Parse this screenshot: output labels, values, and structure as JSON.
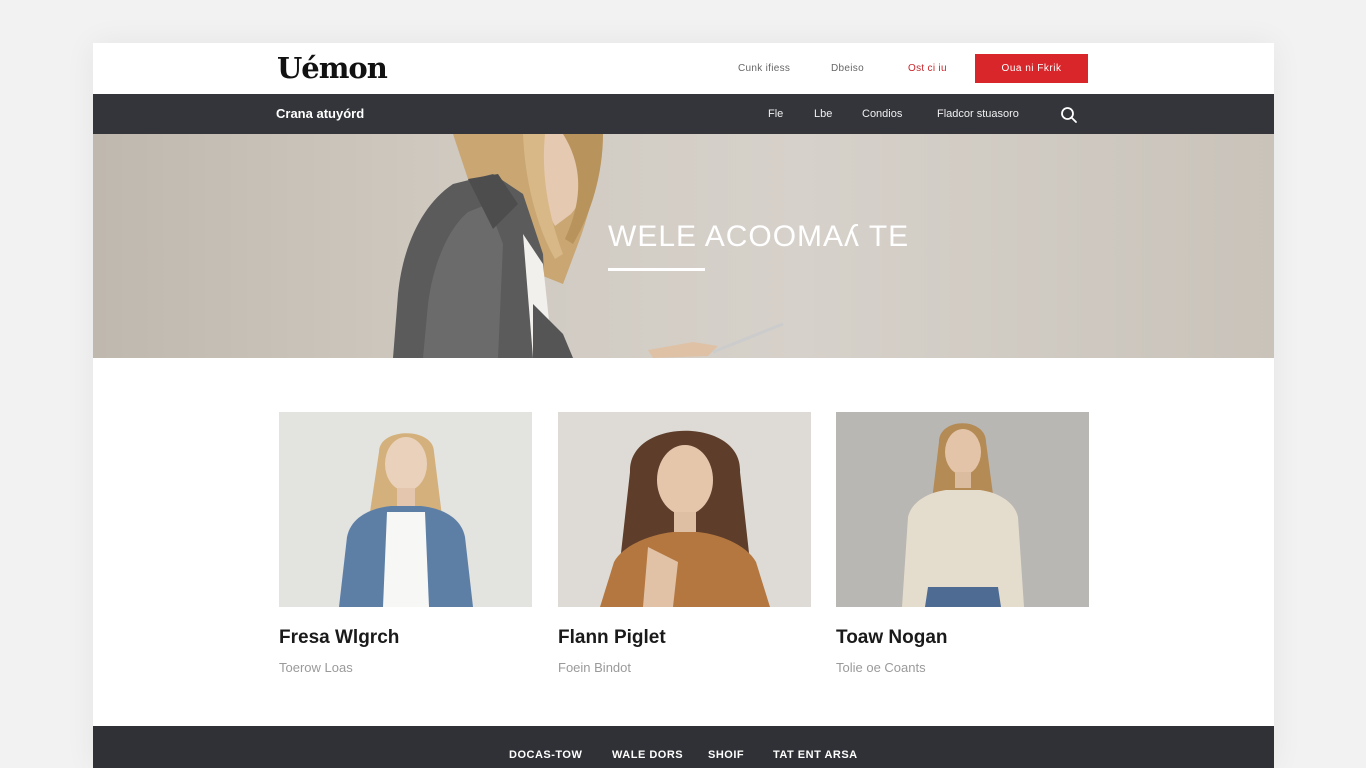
{
  "header": {
    "logo": "Uémon",
    "links": [
      "Cunk ifiess",
      "Dbeiso",
      "Ost ci iu"
    ],
    "cta_label": "Oua ni Fkrik",
    "accent_color": "#d8262a"
  },
  "nav": {
    "brand": "Crana atuyórd",
    "links": [
      "Fle",
      "Lbe",
      "Condios",
      "Fladcor stuasoro"
    ],
    "search_icon": "search-icon",
    "background": "#33353a"
  },
  "hero": {
    "title": "WELE ACOOMAʎ TE"
  },
  "products": [
    {
      "name": "Fresa Wlgrch",
      "subtitle": "Toerow Loas",
      "image": "model-denim-jacket"
    },
    {
      "name": "Flann Piglet",
      "subtitle": "Foein Bindot",
      "image": "model-tan-blazer"
    },
    {
      "name": "Toaw Nogan",
      "subtitle": "Tolie oe Coants",
      "image": "model-cream-blouse"
    }
  ],
  "footer": {
    "links": [
      "DOCAS-TOW",
      "WALE DORS",
      "SHOIF",
      "TAT ENT ARSA"
    ],
    "background": "#2f3136"
  }
}
